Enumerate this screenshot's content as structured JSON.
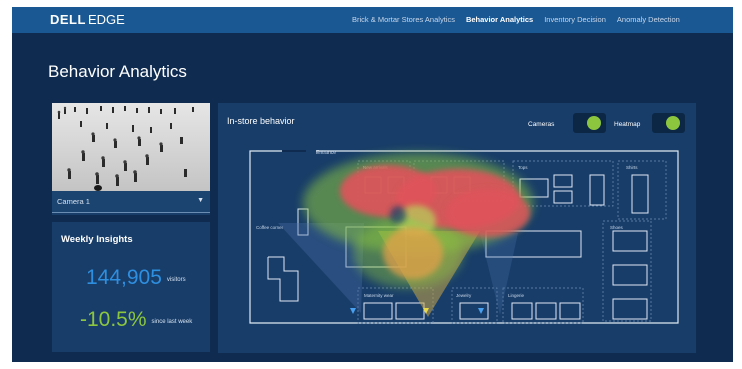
{
  "brand": {
    "logo": "DELL",
    "product": "EDGE"
  },
  "nav": {
    "items": [
      {
        "label": "Brick & Mortar Stores Analytics",
        "active": false
      },
      {
        "label": "Behavior Analytics",
        "active": true
      },
      {
        "label": "Inventory Decision",
        "active": false
      },
      {
        "label": "Anomaly Detection",
        "active": false
      }
    ]
  },
  "page": {
    "title": "Behavior Analytics"
  },
  "camera": {
    "selected": "Camera 1"
  },
  "insights": {
    "title": "Weekly Insights",
    "visitors_value": "144,905",
    "visitors_unit": "visitors",
    "change_value": "-10.5%",
    "change_unit": "since last week"
  },
  "store": {
    "title": "In-store behavior",
    "toggles": {
      "cameras_label": "Cameras",
      "cameras_on": true,
      "heatmap_label": "Heatmap",
      "heatmap_on": true
    },
    "zones": {
      "entrance": "Entrance",
      "new_arrivals": "New arrivals",
      "tops": "Tops",
      "shirts": "Shirts",
      "coffee_corner": "Coffee corner",
      "shoes": "Shoes",
      "maternity_wear": "Maternity wear",
      "jewelry": "Jewelry",
      "lingerie": "Lingerie"
    }
  },
  "colors": {
    "accent_green": "#8cc63f",
    "accent_blue": "#2e8fe0",
    "topbar": "#1a5894",
    "background": "#0f2b50",
    "panel": "#183d69"
  }
}
